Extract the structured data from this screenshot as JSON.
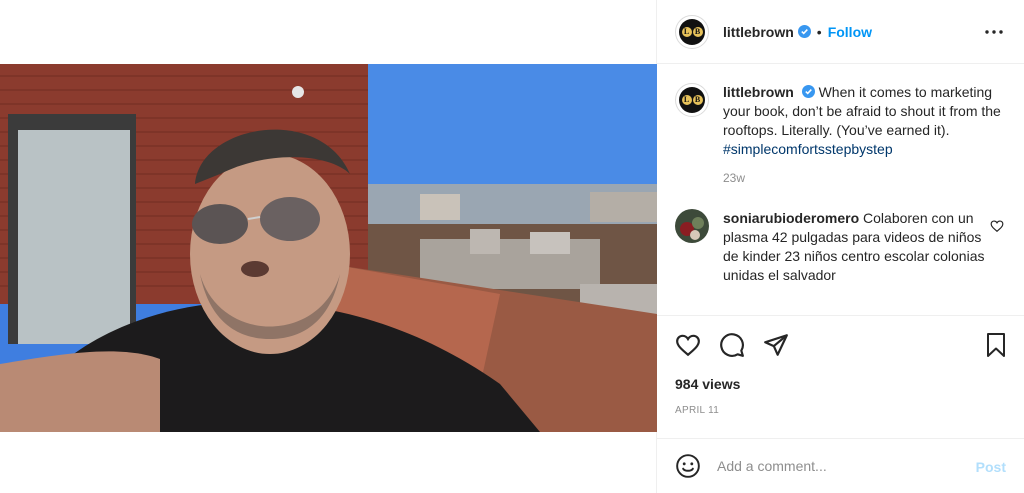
{
  "header": {
    "avatar_letters": [
      "L",
      "B"
    ],
    "username": "littlebrown",
    "separator": "•",
    "follow_label": "Follow"
  },
  "caption": {
    "username": "littlebrown",
    "text": "When it comes to marketing your book, don’t be afraid to shout it from the rooftops. Literally. (You’ve earned it).",
    "hashtag": "#simplecomfortsstepbystep",
    "age": "23w"
  },
  "comments": [
    {
      "username": "soniarubioderomero",
      "text": "Colaboren con un plasma 42 pulgadas para videos de niños de kinder 23 niños centro escolar colonias unidas el salvador"
    }
  ],
  "stats": {
    "views": "984 views",
    "date": "APRIL 11"
  },
  "add_comment": {
    "placeholder": "Add a comment...",
    "post_label": "Post"
  },
  "icons": {
    "verified": "verified-badge-icon",
    "more": "more-options-icon",
    "like": "heart-icon",
    "comment": "comment-bubble-icon",
    "share": "paper-plane-icon",
    "save": "bookmark-icon",
    "emoji": "emoji-icon"
  },
  "colors": {
    "accent": "#0095f6",
    "post_disabled": "#b2dffc",
    "hashtag": "#00376b",
    "muted": "#8e8e8e",
    "border": "#efefef"
  }
}
